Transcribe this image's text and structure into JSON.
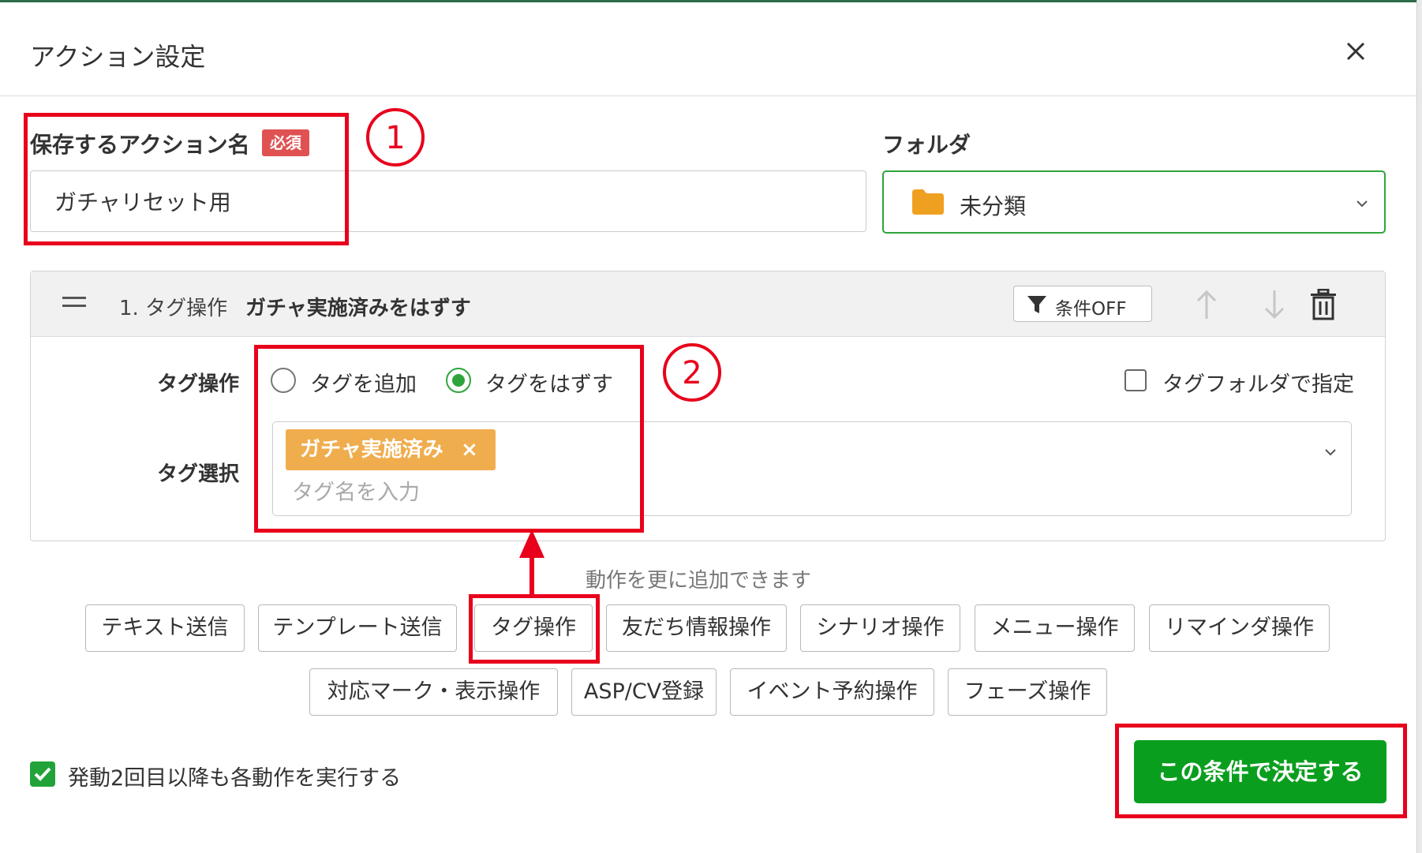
{
  "modal": {
    "title": "アクション設定"
  },
  "form": {
    "action_name_label": "保存するアクション名",
    "required_badge": "必須",
    "action_name_value": "ガチャリセット用",
    "folder_label": "フォルダ",
    "folder_value": "未分類"
  },
  "action_card": {
    "number": "1. タグ操作",
    "summary": "ガチャ実施済みをはずす",
    "condition_button": "条件OFF",
    "tag_operation_label": "タグ操作",
    "option_add": "タグを追加",
    "option_remove": "タグをはずす",
    "selected_option": "option_remove",
    "folder_specify_label": "タグフォルダで指定",
    "tag_select_label": "タグ選択",
    "selected_tag": "ガチャ実施済み",
    "chip_remove_glyph": "×",
    "tag_input_placeholder": "タグ名を入力"
  },
  "add_actions": {
    "hint": "動作を更に追加できます",
    "buttons": [
      "テキスト送信",
      "テンプレート送信",
      "タグ操作",
      "友だち情報操作",
      "シナリオ操作",
      "メニュー操作",
      "リマインダ操作",
      "対応マーク・表示操作",
      "ASP/CV登録",
      "イベント予約操作",
      "フェーズ操作"
    ]
  },
  "footer": {
    "repeat_label": "発動2回目以降も各動作を実行する",
    "repeat_checked": true,
    "submit_label": "この条件で決定する"
  },
  "annotations": {
    "marker_1": "①",
    "marker_2": "②",
    "color": "#e8001c"
  },
  "icons": {
    "close": "close-icon",
    "folder": "folder-icon",
    "chevron": "chevron-down-icon",
    "drag": "drag-handle-icon",
    "filter": "filter-icon",
    "up": "arrow-up-icon",
    "down": "arrow-down-icon",
    "trash": "trash-icon",
    "check": "check-icon"
  },
  "colors": {
    "brand_green": "#0a9e1e",
    "radio_green": "#2ea53c",
    "tag_chip": "#f0ad4e",
    "required_red": "#e05252"
  }
}
